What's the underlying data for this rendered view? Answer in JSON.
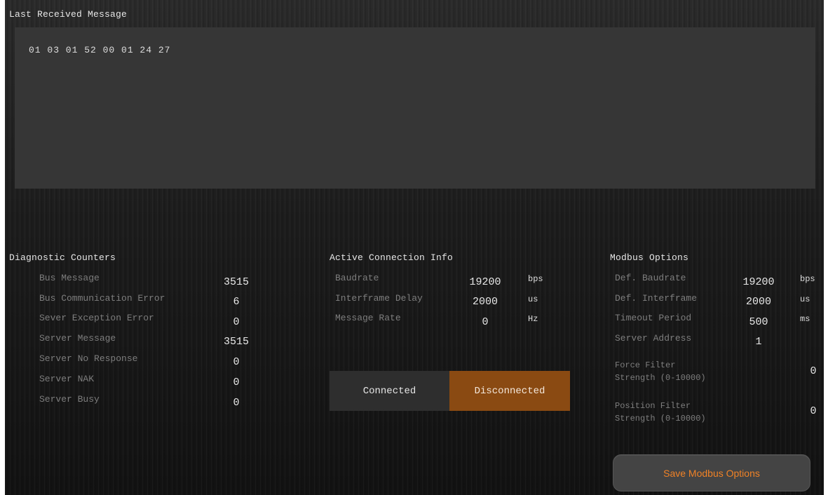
{
  "last_message": {
    "title": "Last Received Message",
    "content": "01 03 01 52 00 01 24 27"
  },
  "diagnostics": {
    "title": "Diagnostic Counters",
    "rows": [
      {
        "label": "Bus Message",
        "value": "3515"
      },
      {
        "label": "Bus Communication Error",
        "value": "6"
      },
      {
        "label": "Sever Exception Error",
        "value": "0"
      },
      {
        "label": "Server Message",
        "value": "3515"
      },
      {
        "label": "Server No Response",
        "value": "0"
      },
      {
        "label": "Server NAK",
        "value": "0"
      },
      {
        "label": "Server Busy",
        "value": "0"
      }
    ]
  },
  "connection": {
    "title": "Active Connection Info",
    "rows": [
      {
        "label": "Baudrate",
        "value": "19200",
        "unit": "bps"
      },
      {
        "label": "Interframe Delay",
        "value": "2000",
        "unit": "us"
      },
      {
        "label": "Message Rate",
        "value": "0",
        "unit": "Hz"
      }
    ],
    "connected_label": "Connected",
    "disconnected_label": "Disconnected",
    "state": "disconnected"
  },
  "modbus": {
    "title": "Modbus Options",
    "rows": [
      {
        "label": "Def. Baudrate",
        "value": "19200",
        "unit": "bps"
      },
      {
        "label": "Def. Interframe",
        "value": "2000",
        "unit": "us"
      },
      {
        "label": "Timeout Period",
        "value": "500",
        "unit": "ms"
      },
      {
        "label": "Server Address",
        "value": "1",
        "unit": ""
      }
    ],
    "force_filter": {
      "label_line1": "Force Filter",
      "label_line2": "Strength (0-10000)",
      "value": "0"
    },
    "position_filter": {
      "label_line1": "Position Filter",
      "label_line2": "Strength (0-10000)",
      "value": "0"
    },
    "save_label": "Save Modbus Options"
  },
  "colors": {
    "accent_orange": "#f08226",
    "disconnected_bg": "#8a4a12",
    "panel_bg": "#151515"
  }
}
